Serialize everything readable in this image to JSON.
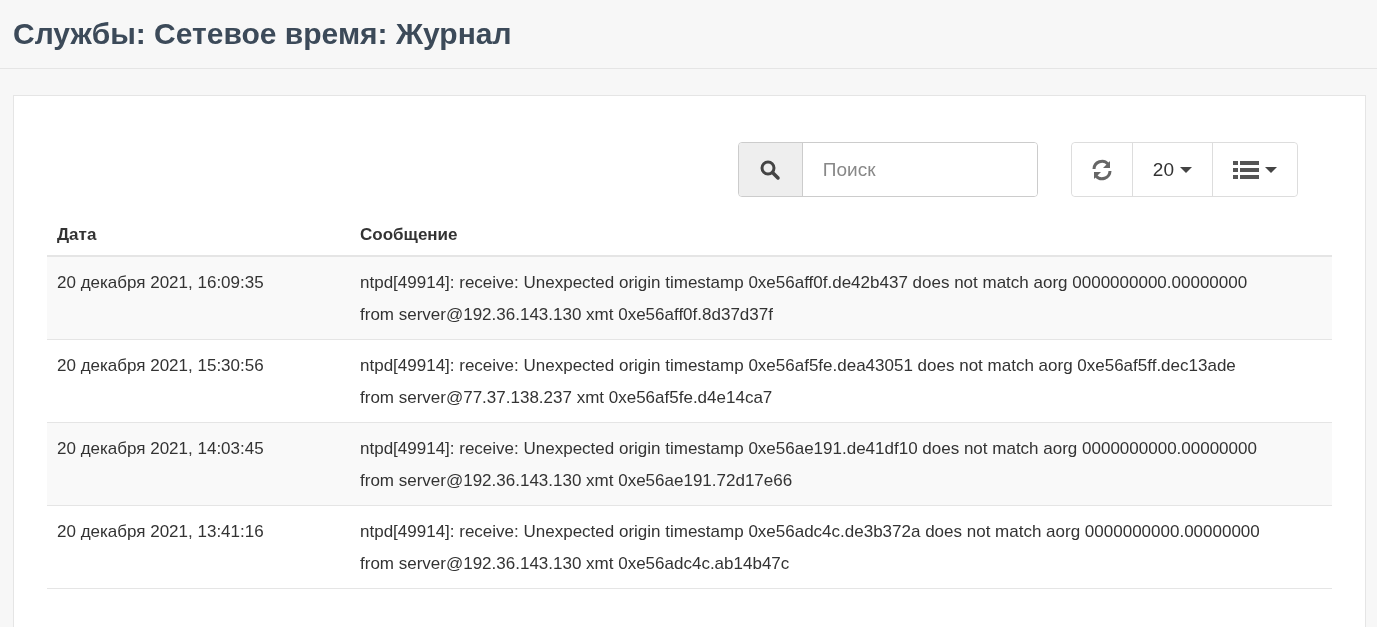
{
  "page_title": "Службы: Сетевое время: Журнал",
  "toolbar": {
    "search": {
      "placeholder": "Поиск"
    },
    "page_size": "20"
  },
  "table": {
    "columns": [
      "Дата",
      "Сообщение"
    ],
    "rows": [
      {
        "date": "20 декабря 2021, 16:09:35",
        "message": "ntpd[49914]: receive: Unexpected origin timestamp 0xe56aff0f.de42b437 does not match aorg 0000000000.00000000 from server@192.36.143.130 xmt 0xe56aff0f.8d37d37f"
      },
      {
        "date": "20 декабря 2021, 15:30:56",
        "message": "ntpd[49914]: receive: Unexpected origin timestamp 0xe56af5fe.dea43051 does not match aorg 0xe56af5ff.dec13ade from server@77.37.138.237 xmt 0xe56af5fe.d4e14ca7"
      },
      {
        "date": "20 декабря 2021, 14:03:45",
        "message": "ntpd[49914]: receive: Unexpected origin timestamp 0xe56ae191.de41df10 does not match aorg 0000000000.00000000 from server@192.36.143.130 xmt 0xe56ae191.72d17e66"
      },
      {
        "date": "20 декабря 2021, 13:41:16",
        "message": "ntpd[49914]: receive: Unexpected origin timestamp 0xe56adc4c.de3b372a does not match aorg 0000000000.00000000 from server@192.36.143.130 xmt 0xe56adc4c.ab14b47c"
      }
    ]
  }
}
